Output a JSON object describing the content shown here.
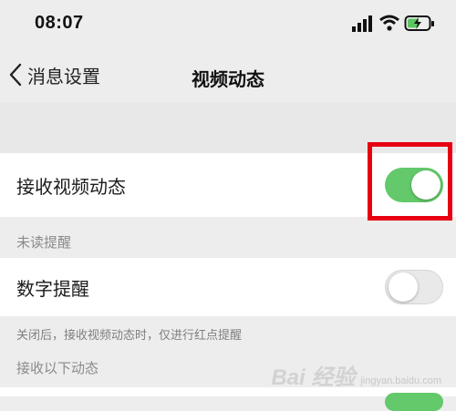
{
  "status_bar": {
    "time": "08:07",
    "icons": [
      "signal-icon",
      "wifi-icon",
      "battery-charging-icon"
    ]
  },
  "nav": {
    "back_label": "消息设置",
    "title": "视频动态"
  },
  "rows": {
    "receive_video_updates": {
      "label": "接收视频动态",
      "toggle_on": true
    },
    "number_badge": {
      "label": "数字提醒",
      "toggle_on": false
    },
    "partial_toggle_on": true
  },
  "sections": {
    "unread_reminder": "未读提醒",
    "receive_following": "接收以下动态"
  },
  "notes": {
    "number_badge_note": "关闭后，接收视频动态时，仅进行红点提醒"
  },
  "watermark": {
    "brand": "Bai 经验",
    "domain": "jingyan.baidu.com"
  },
  "colors": {
    "toggle_on": "#63c96a",
    "highlight": "#e60012",
    "background": "#ededed"
  }
}
